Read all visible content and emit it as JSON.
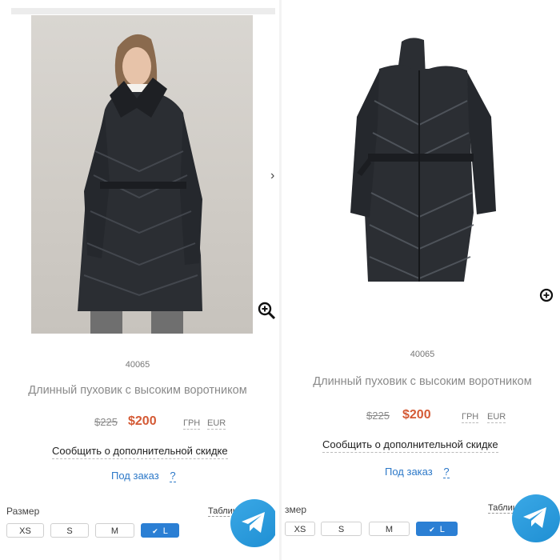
{
  "left": {
    "sku": "40065",
    "title": "Длинный пуховик с высоким воротником",
    "old_price": "$225",
    "new_price": "$200",
    "currencies": [
      "ГРН",
      "EUR"
    ],
    "discount_link": "Сообщить о дополнительной скидке",
    "order_label": "Под заказ",
    "order_help": "?",
    "size_label": "Размер",
    "size_table_label": "Таблиц",
    "sizes": [
      "XS",
      "S",
      "M",
      "L"
    ],
    "selected_size": "L"
  },
  "right": {
    "sku": "40065",
    "title": "Длинный пуховик с высоким воротником",
    "old_price": "$225",
    "new_price": "$200",
    "currencies": [
      "ГРН",
      "EUR"
    ],
    "discount_link": "Сообщить о дополнительной скидке",
    "order_label": "Под заказ",
    "order_help": "?",
    "size_label": "змер",
    "size_table_label": "Таблиц",
    "sizes": [
      "XS",
      "S",
      "M",
      "L"
    ],
    "selected_size": "L"
  },
  "colors": {
    "price_accent": "#d45a35",
    "link_blue": "#2c78c8",
    "selected_size_bg": "#2b7fd4",
    "telegram": "#2a9ee0",
    "coat": "#2b2e33"
  },
  "icons": {
    "zoom": "zoom-in-icon",
    "next": "chevron-right-icon",
    "telegram": "telegram-icon",
    "check": "check-icon"
  }
}
